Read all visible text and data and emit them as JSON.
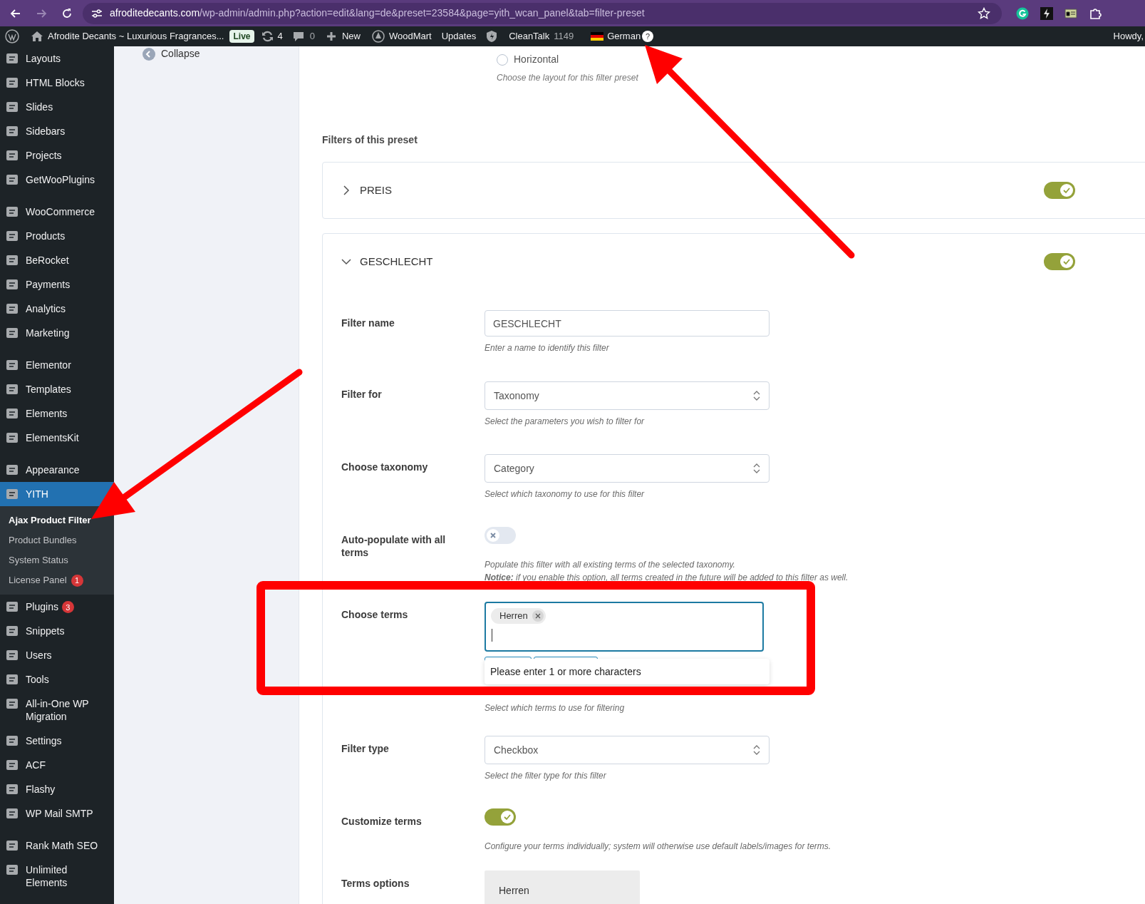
{
  "browser": {
    "url_host": "afroditedecants.com",
    "url_path": "/wp-admin/admin.php?action=edit&lang=de&preset=23584&page=yith_wcan_panel&tab=filter-preset"
  },
  "admin_bar": {
    "site_name": "Afrodite Decants ~ Luxurious Fragrances...",
    "live_badge": "Live",
    "updates_count": "4",
    "comments_count": "0",
    "new_label": "New",
    "woodmart_label": "WoodMart",
    "updates_label": "Updates",
    "cleantalk_label": "CleanTalk",
    "cleantalk_count": "1149",
    "language": "German",
    "help": "?",
    "greeting": "Howdy,"
  },
  "sidebar": {
    "groups": [
      [
        {
          "label": "Layouts",
          "selected": false
        },
        {
          "label": "HTML Blocks",
          "selected": false
        },
        {
          "label": "Slides",
          "selected": false
        },
        {
          "label": "Sidebars",
          "selected": false
        },
        {
          "label": "Projects",
          "selected": false
        },
        {
          "label": "GetWooPlugins",
          "selected": false
        }
      ],
      [
        {
          "label": "WooCommerce",
          "selected": false
        },
        {
          "label": "Products",
          "selected": false
        },
        {
          "label": "BeRocket",
          "selected": false
        },
        {
          "label": "Payments",
          "selected": false
        },
        {
          "label": "Analytics",
          "selected": false
        },
        {
          "label": "Marketing",
          "selected": false
        }
      ],
      [
        {
          "label": "Elementor",
          "selected": false
        },
        {
          "label": "Templates",
          "selected": false
        },
        {
          "label": "Elements",
          "selected": false
        },
        {
          "label": "ElementsKit",
          "selected": false
        }
      ],
      [
        {
          "label": "Appearance",
          "selected": false
        },
        {
          "label": "YITH",
          "selected": true,
          "children": [
            {
              "label": "Ajax Product Filter",
              "selected": true
            },
            {
              "label": "Product Bundles",
              "selected": false
            },
            {
              "label": "System Status",
              "selected": false
            },
            {
              "label": "License Panel",
              "selected": false,
              "badge": "1"
            }
          ]
        },
        {
          "label": "Plugins",
          "selected": false,
          "badge": "3"
        },
        {
          "label": "Snippets",
          "selected": false
        },
        {
          "label": "Users",
          "selected": false
        },
        {
          "label": "Tools",
          "selected": false
        },
        {
          "label": "All-in-One WP Migration",
          "selected": false
        },
        {
          "label": "Settings",
          "selected": false
        },
        {
          "label": "ACF",
          "selected": false
        },
        {
          "label": "Flashy",
          "selected": false
        },
        {
          "label": "WP Mail SMTP",
          "selected": false
        }
      ],
      [
        {
          "label": "Rank Math SEO",
          "selected": false
        },
        {
          "label": "Unlimited Elements",
          "selected": false
        }
      ]
    ]
  },
  "collapse_label": "Collapse",
  "layout_option": {
    "label": "Horizontal",
    "checked": false,
    "hint": "Choose the layout for this filter preset"
  },
  "filters_heading": "Filters of this preset",
  "filters": [
    {
      "title": "PREIS",
      "expanded": false,
      "enabled": true
    },
    {
      "title": "GESCHLECHT",
      "expanded": true,
      "enabled": true,
      "fields": [
        {
          "kind": "text",
          "label": "Filter name",
          "value": "GESCHLECHT",
          "hints": [
            "Enter a name to identify this filter"
          ]
        },
        {
          "kind": "select",
          "label": "Filter for",
          "value": "Taxonomy",
          "hints": [
            "Select the parameters you wish to filter for"
          ]
        },
        {
          "kind": "select",
          "label": "Choose taxonomy",
          "value": "Category",
          "hints": [
            "Select which taxonomy to use for this filter"
          ]
        },
        {
          "kind": "toggle",
          "label": "Auto-populate with all terms",
          "on": false,
          "hints": [
            "Populate this filter with all existing terms of the selected taxonomy.",
            "**Notice:** if you enable this option, all terms created in the future will be added to this filter as well."
          ]
        },
        {
          "kind": "terms",
          "label": "Choose terms",
          "tags": [
            "Herren"
          ],
          "dropdown_message": "Please enter 1 or more characters",
          "hints": [
            "Select which terms to use for filtering"
          ]
        },
        {
          "kind": "select",
          "label": "Filter type",
          "value": "Checkbox",
          "hints": [
            "Select the filter type for this filter"
          ]
        },
        {
          "kind": "toggle",
          "label": "Customize terms",
          "on": true,
          "hints": [
            "Configure your terms individually; system will otherwise use default labels/images for terms."
          ]
        },
        {
          "kind": "term_options",
          "label": "Terms options",
          "terms": [
            "Herren"
          ]
        }
      ]
    }
  ]
}
